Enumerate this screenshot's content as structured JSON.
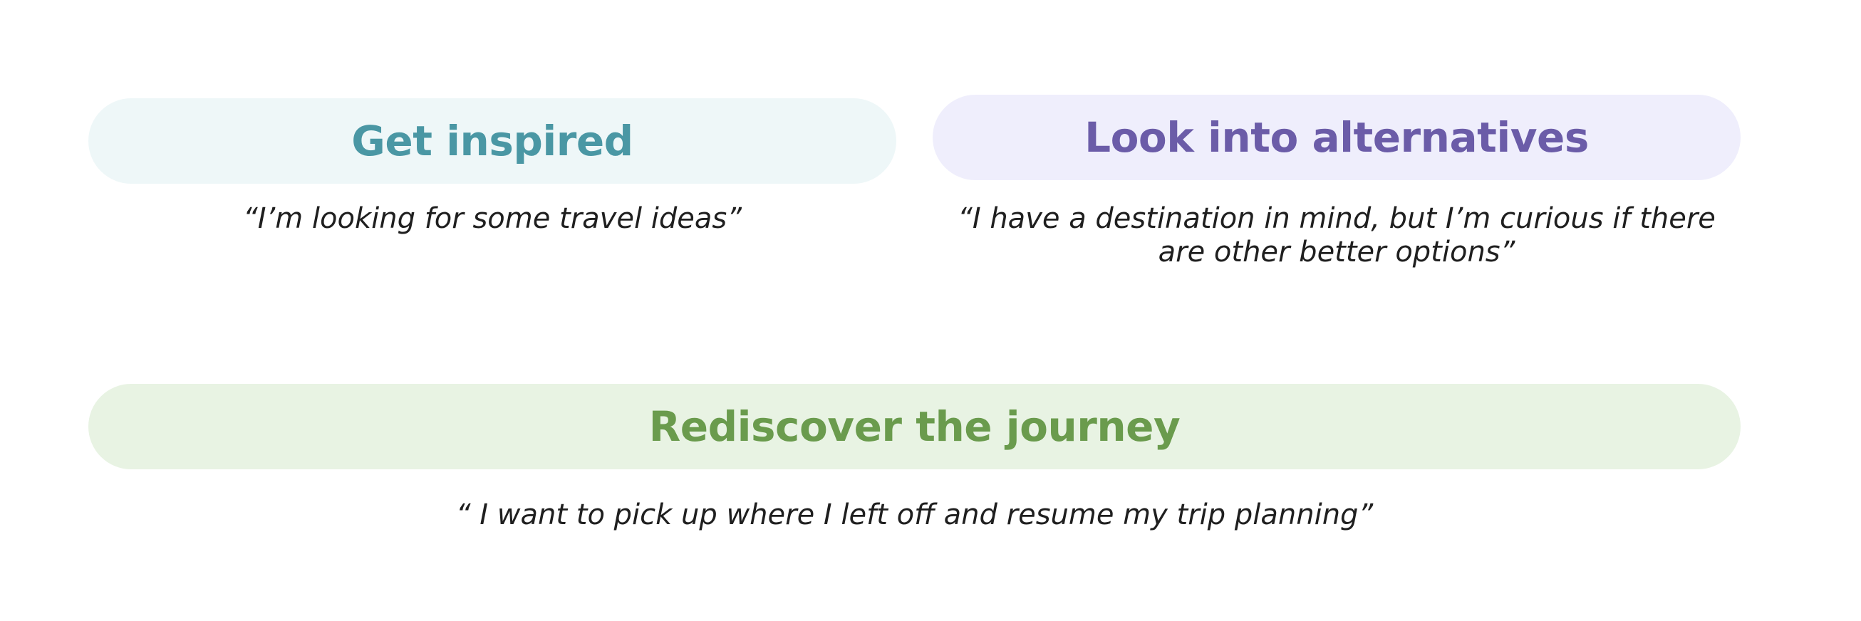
{
  "cards": {
    "inspired": {
      "title": "Get inspired",
      "quote": "“I’m looking for some travel ideas”",
      "color": "#4a97a4",
      "background": "#eef7f8"
    },
    "alternatives": {
      "title": "Look into alternatives",
      "quote": "“I have a destination in mind, but I’m curious if there are other better options”",
      "color": "#6b5ca8",
      "background": "#efeefc"
    },
    "journey": {
      "title": "Rediscover the journey",
      "quote": "“ I want to pick up where I left off and resume my trip planning”",
      "color": "#6a9b4d",
      "background": "#e8f3e3"
    }
  }
}
